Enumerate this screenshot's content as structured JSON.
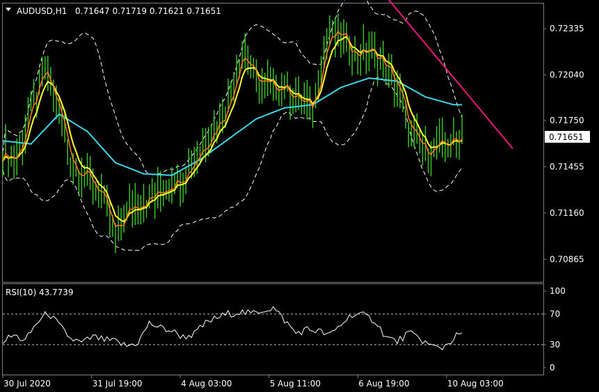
{
  "header": {
    "symbol": "AUDUSD,H1",
    "ohlc": "0.71647 0.71719 0.71621 0.71651"
  },
  "rsi_header": "RSI(10) 43.7739",
  "current_price": "0.71651",
  "colors": {
    "background": "#000000",
    "panel_border": "#808080",
    "candles": "#3ecb2a",
    "ma_fast": "#ff7a1a",
    "ma_slow": "#ffff33",
    "ma_long": "#3fd6e8",
    "bands": "#ffffff",
    "trendline": "#e8197a",
    "rsi_line": "#ffffff"
  },
  "chart_data": [
    {
      "type": "line",
      "title": "AUDUSD,H1",
      "x_tick_labels": [
        "30 Jul 2020",
        "31 Jul 19:00",
        "4 Aug 03:00",
        "5 Aug 11:00",
        "6 Aug 19:00",
        "10 Aug 03:00"
      ],
      "y_tick_labels": [
        "0.72335",
        "0.72040",
        "0.71750",
        "0.71455",
        "0.71160",
        "0.70865"
      ],
      "ylim": [
        0.7072,
        0.725
      ],
      "current_price": 0.71651,
      "series": [
        {
          "role": "price",
          "x": [
            0,
            5,
            10,
            15,
            20,
            25,
            30,
            35,
            40,
            45,
            50,
            55,
            60,
            65,
            70,
            75,
            80,
            85,
            90,
            95,
            100,
            105,
            110,
            115,
            120,
            125,
            130,
            135,
            140,
            145,
            150,
            155,
            160,
            163
          ],
          "values": [
            0.7155,
            0.7151,
            0.7182,
            0.7208,
            0.718,
            0.7145,
            0.714,
            0.7128,
            0.71,
            0.712,
            0.7124,
            0.7128,
            0.7136,
            0.7142,
            0.7156,
            0.717,
            0.7185,
            0.7222,
            0.72,
            0.7196,
            0.7197,
            0.7188,
            0.7182,
            0.7228,
            0.723,
            0.7217,
            0.722,
            0.7212,
            0.7197,
            0.7165,
            0.7155,
            0.7158,
            0.7162,
            0.71651
          ]
        },
        {
          "role": "ma_long",
          "x": [
            0,
            10,
            20,
            30,
            40,
            50,
            60,
            70,
            80,
            90,
            100,
            110,
            120,
            130,
            140,
            150,
            160
          ],
          "values": [
            0.7162,
            0.716,
            0.7179,
            0.7168,
            0.7148,
            0.7141,
            0.714,
            0.715,
            0.7163,
            0.7176,
            0.7183,
            0.7185,
            0.7196,
            0.7202,
            0.72,
            0.719,
            0.7185
          ]
        }
      ],
      "trendline": {
        "x": [
          136,
          181
        ],
        "values": [
          0.7254,
          0.7157
        ]
      }
    },
    {
      "type": "line",
      "title": "RSI(10) 43.7739",
      "y_tick_labels": [
        "100",
        "70",
        "30",
        "0"
      ],
      "ylim": [
        0,
        100
      ],
      "levels": [
        70,
        30
      ],
      "current_value": 43.7739,
      "series": [
        {
          "role": "rsi",
          "x": [
            0,
            4,
            8,
            12,
            16,
            20,
            24,
            28,
            32,
            36,
            40,
            44,
            48,
            52,
            56,
            60,
            64,
            68,
            72,
            76,
            80,
            84,
            88,
            92,
            96,
            100,
            104,
            108,
            112,
            116,
            120,
            124,
            128,
            132,
            136,
            140,
            144,
            148,
            152,
            156,
            160,
            162
          ],
          "values": [
            35,
            42,
            35,
            58,
            72,
            55,
            38,
            32,
            40,
            36,
            34,
            28,
            33,
            58,
            52,
            48,
            40,
            44,
            58,
            65,
            70,
            73,
            70,
            75,
            78,
            62,
            45,
            50,
            48,
            42,
            56,
            70,
            68,
            62,
            40,
            34,
            45,
            38,
            28,
            26,
            38,
            44
          ]
        }
      ]
    }
  ]
}
